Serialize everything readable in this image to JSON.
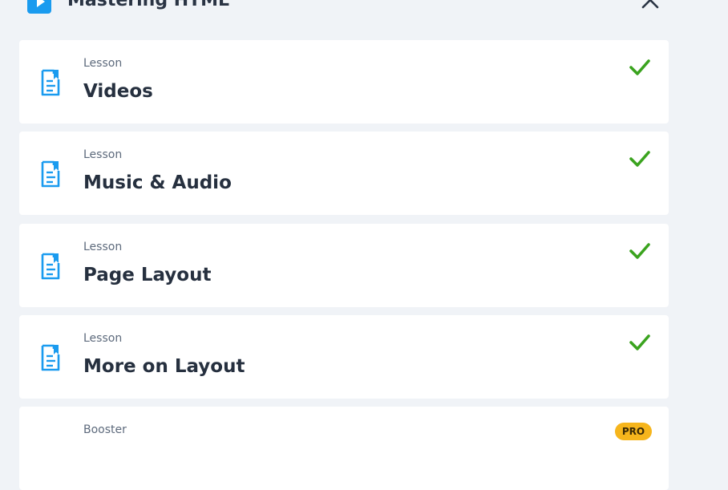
{
  "course": {
    "title": "Mastering HTML",
    "icon": "play-icon",
    "close_icon": "close-icon"
  },
  "lessons": [
    {
      "kind": "Lesson",
      "title": "Videos",
      "completed": true,
      "icon": "lesson-doc-icon"
    },
    {
      "kind": "Lesson",
      "title": "Music & Audio",
      "completed": true,
      "icon": "lesson-doc-icon"
    },
    {
      "kind": "Lesson",
      "title": "Page Layout",
      "completed": true,
      "icon": "lesson-doc-icon"
    },
    {
      "kind": "Lesson",
      "title": "More on Layout",
      "completed": true,
      "icon": "lesson-doc-icon"
    },
    {
      "kind": "Booster",
      "title": "",
      "badge": "PRO"
    }
  ],
  "colors": {
    "background": "#f0f3f7",
    "accent": "#1a9bef",
    "check": "#3aa31e",
    "pro_badge": "#f6b51c"
  }
}
